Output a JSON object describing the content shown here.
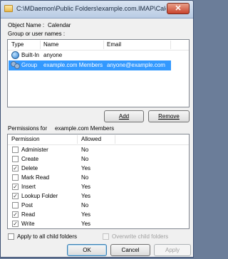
{
  "window": {
    "title": "C:\\MDaemon\\Public Folders\\example.com.IMAP\\Calendar...",
    "close_label": "✕"
  },
  "object_name": {
    "label": "Object Name :",
    "value": "Calendar"
  },
  "users": {
    "label": "Group or user names :",
    "columns": [
      "Type",
      "Name",
      "Email"
    ],
    "rows": [
      {
        "type": "Built-In",
        "name": "anyone",
        "email": "",
        "icon": "globe-icon",
        "selected": false
      },
      {
        "type": "Group",
        "name": "example.com Members",
        "email": "anyone@example.com",
        "icon": "group-icon",
        "selected": true
      }
    ]
  },
  "buttons": {
    "add": "Add",
    "remove": "Remove",
    "ok": "OK",
    "cancel": "Cancel",
    "apply": "Apply"
  },
  "permissions": {
    "label": "Permissions for",
    "target": "example.com Members",
    "columns": [
      "Permission",
      "Allowed"
    ],
    "rows": [
      {
        "name": "Administer",
        "allowed": "No",
        "checked": false
      },
      {
        "name": "Create",
        "allowed": "No",
        "checked": false
      },
      {
        "name": "Delete",
        "allowed": "Yes",
        "checked": true
      },
      {
        "name": "Mark Read",
        "allowed": "No",
        "checked": false
      },
      {
        "name": "Insert",
        "allowed": "Yes",
        "checked": true
      },
      {
        "name": "Lookup Folder",
        "allowed": "Yes",
        "checked": true
      },
      {
        "name": "Post",
        "allowed": "No",
        "checked": false
      },
      {
        "name": "Read",
        "allowed": "Yes",
        "checked": true
      },
      {
        "name": "Write",
        "allowed": "Yes",
        "checked": true
      }
    ]
  },
  "options": {
    "apply_child": {
      "label": "Apply to all child folders",
      "checked": false
    },
    "overwrite_child": {
      "label": "Overwrite child folders",
      "checked": false,
      "disabled": true
    }
  },
  "colors": {
    "selection": "#3399ff",
    "titlebar": "#c8d7ea",
    "face": "#f0f0f0"
  }
}
